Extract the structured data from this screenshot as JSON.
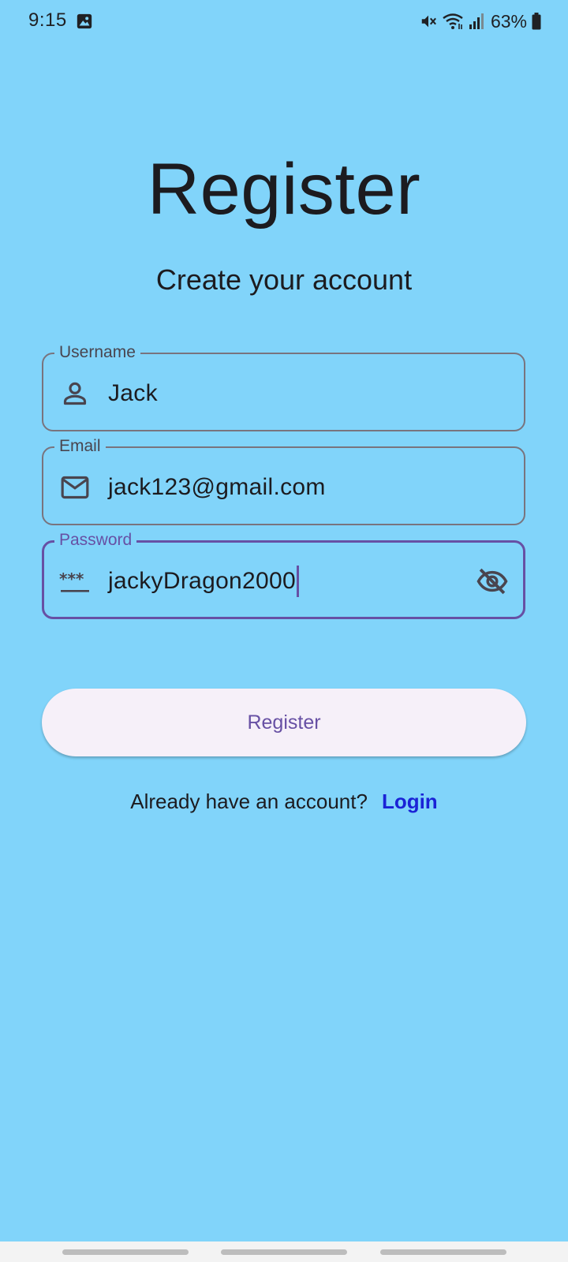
{
  "status_bar": {
    "time": "9:15",
    "battery": "63%",
    "icons": [
      "image-icon",
      "mute-icon",
      "wifi-icon",
      "signal-icon",
      "battery-icon"
    ]
  },
  "page": {
    "title": "Register",
    "subtitle": "Create your account"
  },
  "form": {
    "username": {
      "label": "Username",
      "value": "Jack",
      "icon": "person-icon"
    },
    "email": {
      "label": "Email",
      "value": "jack123@gmail.com",
      "icon": "mail-icon"
    },
    "password": {
      "label": "Password",
      "value": "jackyDragon2000",
      "icon": "password-icon",
      "toggle_icon": "visibility-off-icon",
      "focused": true
    }
  },
  "register_button": {
    "label": "Register"
  },
  "login_prompt": {
    "text": "Already have an account?",
    "link": "Login"
  },
  "colors": {
    "background": "#81d4fa",
    "accent": "#6750a4",
    "link": "#1a23d6",
    "button_bg": "#f6f0f9",
    "outline": "#79747e"
  }
}
